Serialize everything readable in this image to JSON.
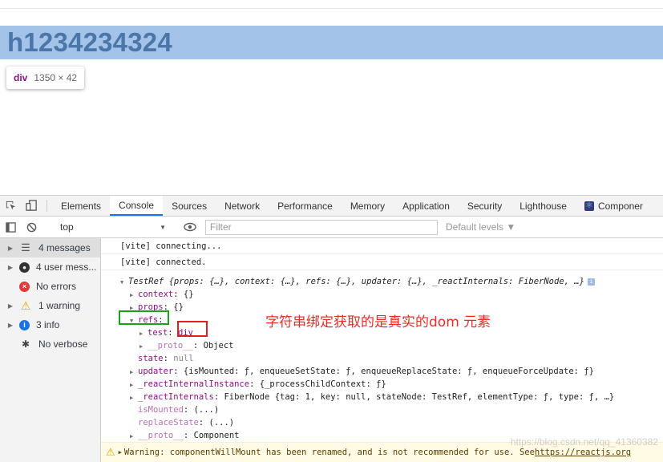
{
  "page": {
    "heading_text": "h1234234324",
    "tooltip": {
      "tag": "div",
      "size": "1350 × 42"
    }
  },
  "devtools": {
    "tabs": [
      "Elements",
      "Console",
      "Sources",
      "Network",
      "Performance",
      "Memory",
      "Application",
      "Security",
      "Lighthouse",
      "Componer"
    ],
    "active_tab": "Console",
    "context_select": "top",
    "filter_placeholder": "Filter",
    "levels_label": "Default levels ▼",
    "sidebar": [
      {
        "label": "4 messages",
        "icon": "list-icon",
        "expandable": true
      },
      {
        "label": "4 user mess...",
        "icon": "user-icon",
        "expandable": true
      },
      {
        "label": "No errors",
        "icon": "error-icon",
        "expandable": false
      },
      {
        "label": "1 warning",
        "icon": "warning-icon",
        "expandable": true
      },
      {
        "label": "3 info",
        "icon": "info-icon",
        "expandable": true
      },
      {
        "label": "No verbose",
        "icon": "bug-icon",
        "expandable": false
      }
    ],
    "console": {
      "line1": "[vite] connecting...",
      "line2": "[vite] connected.",
      "obj_header": "TestRef {props: {…}, context: {…}, refs: {…}, updater: {…}, _reactInternals: FiberNode, …}",
      "context_key": "context",
      "context_val": "{}",
      "props_key": "props",
      "props_val": "{}",
      "refs_key": "refs",
      "test_key": "test",
      "test_val": "div",
      "proto_key": "__proto__",
      "proto_val": "Object",
      "state_key": "state",
      "state_val": "null",
      "updater_key": "updater",
      "updater_val": "{isMounted: ƒ, enqueueSetState: ƒ, enqueueReplaceState: ƒ, enqueueForceUpdate: ƒ}",
      "rii_key": "_reactInternalInstance",
      "rii_val": "{_processChildContext: ƒ}",
      "ri_key": "_reactInternals",
      "ri_val": "FiberNode {tag: 1, key: null, stateNode: TestRef, elementType: ƒ, type: ƒ, …}",
      "ismounted_key": "isMounted",
      "ismounted_val": "(...)",
      "replacestate_key": "replaceState",
      "replacestate_val": "(...)",
      "proto2_key": "__proto__",
      "proto2_val": "Component"
    },
    "warning": {
      "prefix": "Warning: componentWillMount has been renamed, and is not recommended for use. See ",
      "link": "https://reactjs.org"
    }
  },
  "annotation": "字符串绑定获取的是真实的dom 元素",
  "watermark": "https://blog.csdn.net/qq_41360382"
}
